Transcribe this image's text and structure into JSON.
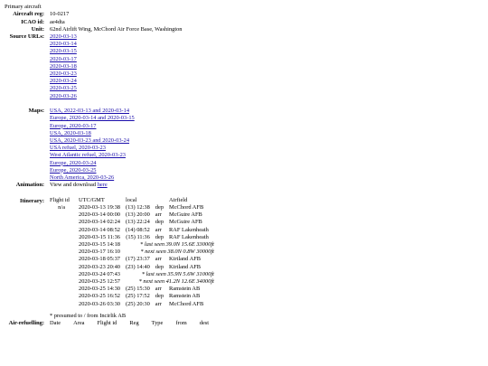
{
  "caption": "Primary aircraft",
  "info": {
    "reg_label": "Aircraft reg:",
    "reg": "10-0217",
    "icao_label": "ICAO id:",
    "icao": "ae4dta",
    "unit_label": "Unit:",
    "unit": "62nd Airlift Wing, McChord Air Force Base, Washington"
  },
  "source_urls": {
    "label": "Source URLs:",
    "links": [
      "2020-03-13",
      "2020-03-14",
      "2020-03-15",
      "2020-03-17",
      "2020-03-18",
      "2020-03-23",
      "2020-03-24",
      "2020-03-25",
      "2020-03-26"
    ]
  },
  "maps": {
    "label": "Maps:",
    "links": [
      "USA, 2022-03-13 and 2020-03-14",
      "Europe, 2020-03-14 and 2020-03-15",
      "Europe, 2020-03-17",
      "USA, 2020-03-18",
      "USA, 2020-03-23 and 2020-03-24",
      "USA refuel, 2020-03-23",
      "West Atlantic refuel, 2020-03-23",
      "Europe, 2020-03-24",
      "Europe, 2020-03-25",
      "North America, 2020-03-26"
    ]
  },
  "animation": {
    "label": "Animation:",
    "text": "View and download ",
    "link": "here"
  },
  "itinerary": {
    "label": "Itinerary:",
    "headers": [
      "Flight id",
      "UTC/GMT",
      "local",
      "Airfield"
    ],
    "flight_id": "n/a",
    "rows": [
      {
        "utc": "2020-03-13 19:38",
        "local": "(13) 12:38",
        "dir": "dep",
        "airfield": "McChord AFB",
        "note": ""
      },
      {
        "utc": "2020-03-14 00:00",
        "local": "(13) 20:00",
        "dir": "arr",
        "airfield": "McGuire AFB",
        "note": ""
      },
      {
        "utc": "2020-03-14 02:24",
        "local": "(13) 22:24",
        "dir": "dep",
        "airfield": "McGuire AFB",
        "note": ""
      },
      {
        "utc": "2020-03-14 08:52",
        "local": "(14) 08:52",
        "dir": "arr",
        "airfield": "RAF Lakenheath",
        "note": ""
      },
      {
        "utc": "2020-03-15 11:36",
        "local": "(15) 11:36",
        "dir": "dep",
        "airfield": "RAF Lakenheath",
        "note": ""
      },
      {
        "utc": "2020-03-15 14:18",
        "local": "",
        "dir": "",
        "airfield": "",
        "note": "* last seen 39.0N 15.6E 33000ft"
      },
      {
        "utc": "2020-03-17 16:10",
        "local": "",
        "dir": "",
        "airfield": "",
        "note": "* next seen 38.0N 0.8W 30000ft"
      },
      {
        "utc": "2020-03-18 05:37",
        "local": "(17) 23:37",
        "dir": "arr",
        "airfield": "Kirtland AFB",
        "note": ""
      },
      {
        "utc": "2020-03-23 20:40",
        "local": "(23) 14:40",
        "dir": "dep",
        "airfield": "Kirtland AFB",
        "note": ""
      },
      {
        "utc": "2020-03-24 07:43",
        "local": "",
        "dir": "",
        "airfield": "",
        "note": "* last seen 35.9N 5.6W 31000ft"
      },
      {
        "utc": "2020-03-25 12:57",
        "local": "",
        "dir": "",
        "airfield": "",
        "note": "* next seen 41.2N 12.6E 34000ft"
      },
      {
        "utc": "2020-03-25 14:30",
        "local": "(25) 15:30",
        "dir": "arr",
        "airfield": "Ramstein AB",
        "note": ""
      },
      {
        "utc": "2020-03-25 16:52",
        "local": "(25) 17:52",
        "dir": "dep",
        "airfield": "Ramstein AB",
        "note": ""
      },
      {
        "utc": "2020-03-26 03:30",
        "local": "(25) 20:30",
        "dir": "arr",
        "airfield": "McChord AFB",
        "note": ""
      }
    ],
    "footnote": "* presumed to / from Incirlik AB"
  },
  "air_refuelling": {
    "label": "Air-refuelling:",
    "headers": [
      "Date",
      "Area",
      "Flight id",
      "Reg",
      "Type",
      "from",
      "dest"
    ]
  }
}
